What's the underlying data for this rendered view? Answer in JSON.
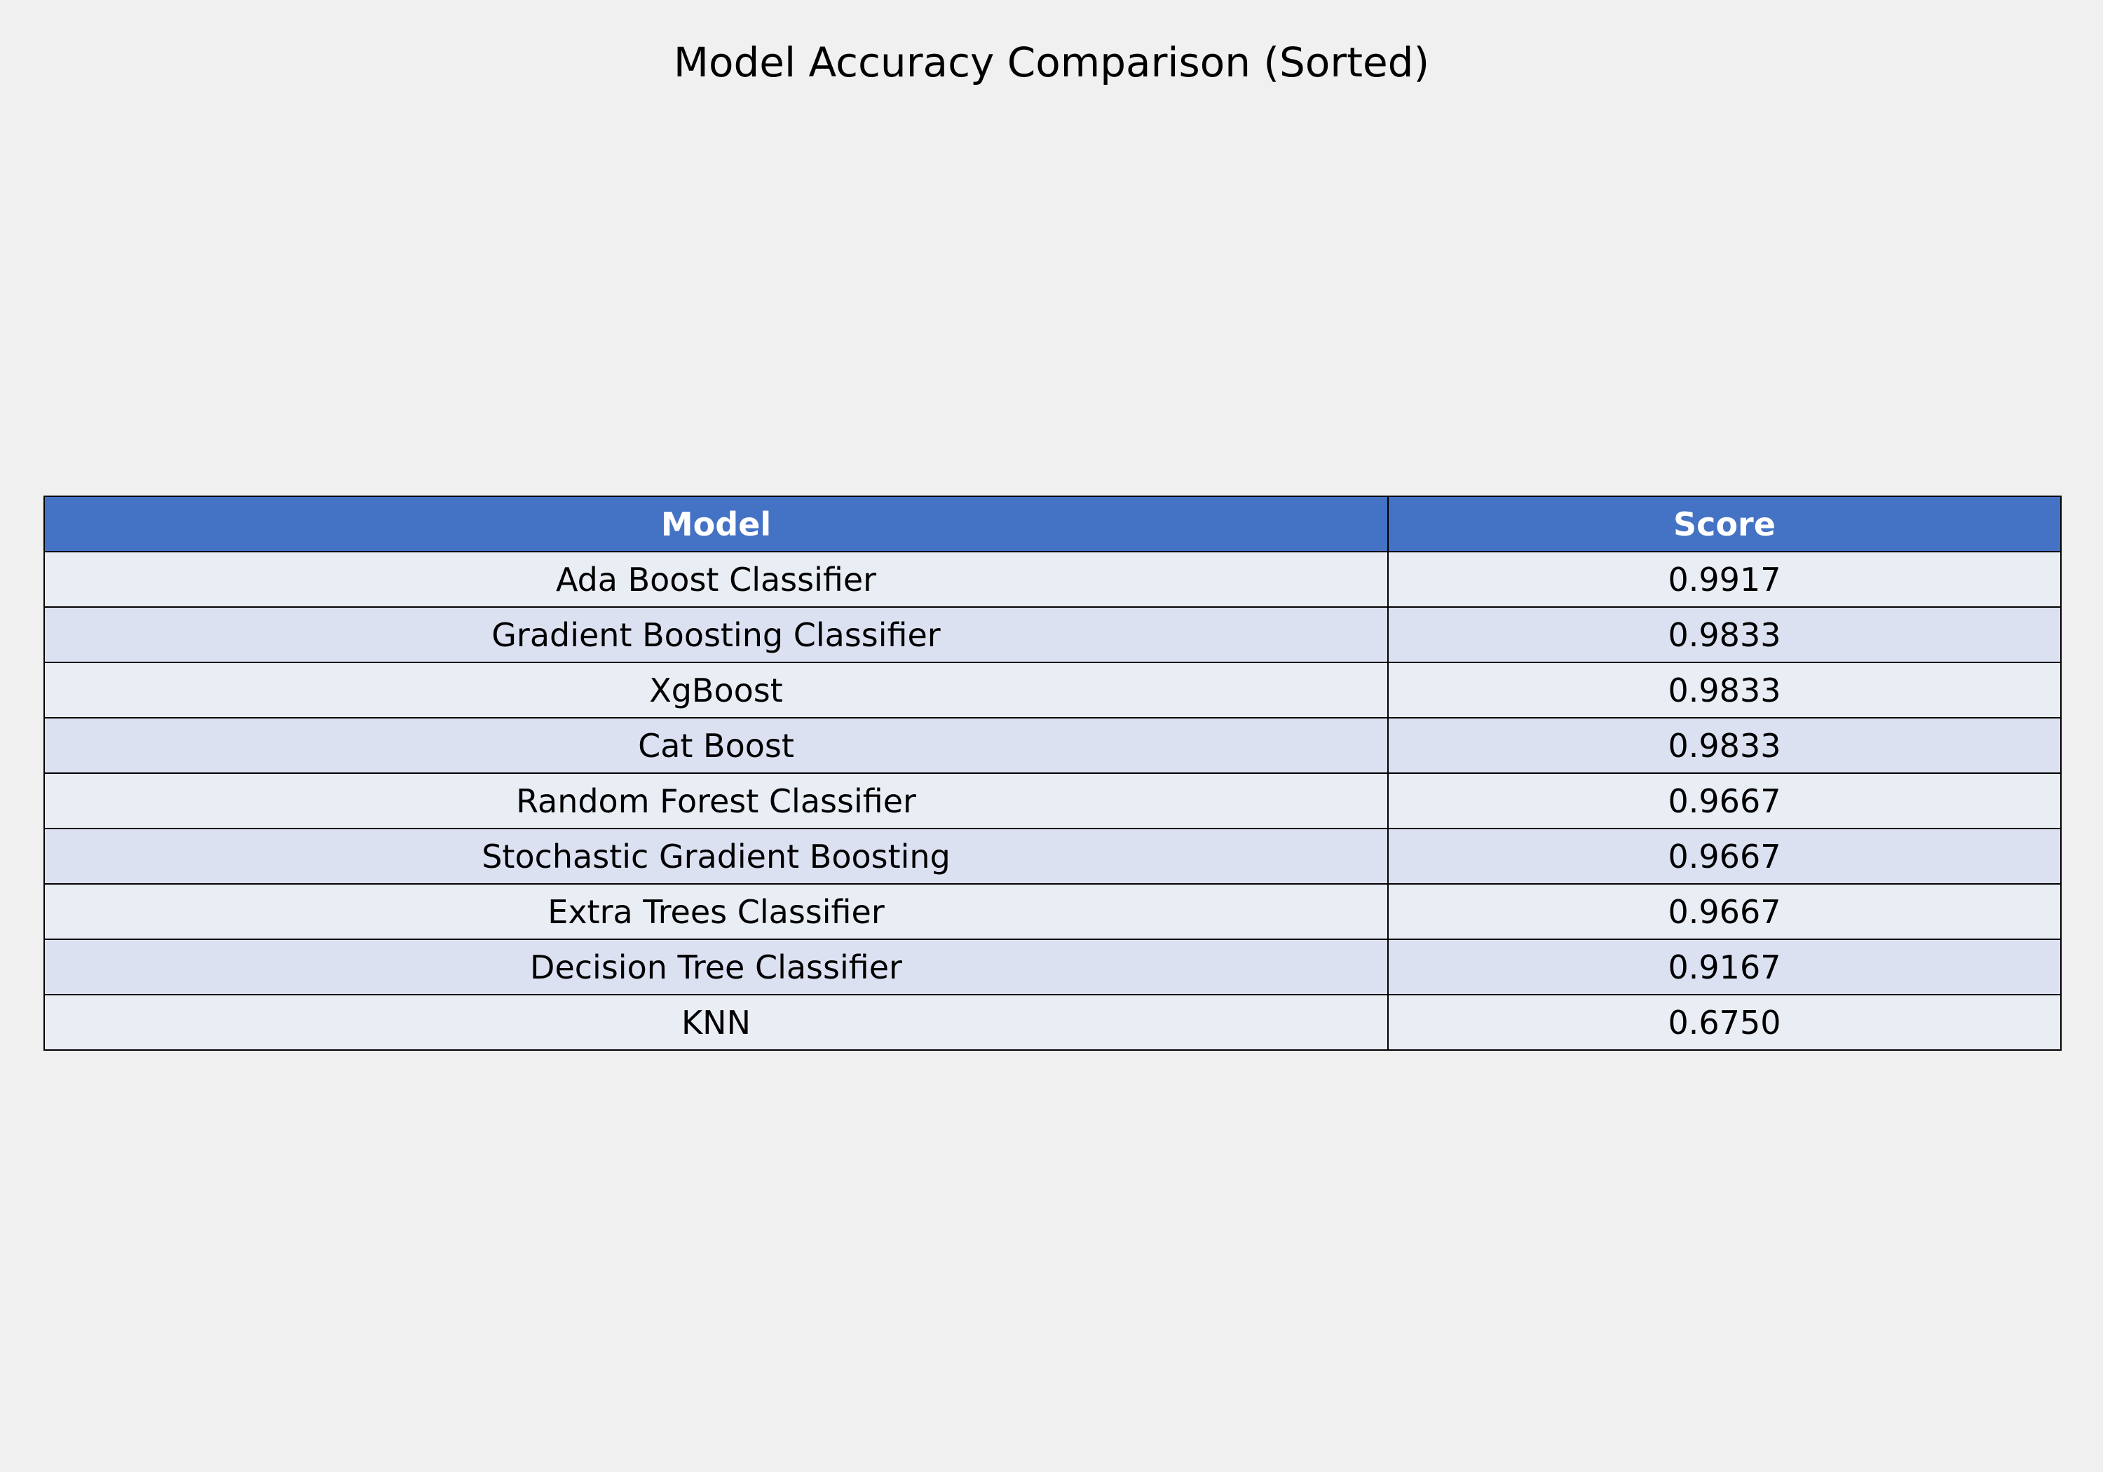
{
  "chart_data": {
    "type": "table",
    "title": "Model Accuracy Comparison (Sorted)",
    "columns": [
      "Model",
      "Score"
    ],
    "rows": [
      [
        "Ada Boost Classifier",
        "0.9917"
      ],
      [
        "Gradient Boosting Classifier",
        "0.9833"
      ],
      [
        "XgBoost",
        "0.9833"
      ],
      [
        "Cat Boost",
        "0.9833"
      ],
      [
        "Random Forest Classifier",
        "0.9667"
      ],
      [
        "Stochastic Gradient Boosting",
        "0.9667"
      ],
      [
        "Extra Trees Classifier",
        "0.9667"
      ],
      [
        "Decision Tree Classifier",
        "0.9167"
      ],
      [
        "KNN",
        "0.6750"
      ]
    ],
    "sort_order": "descending by Score"
  },
  "colors": {
    "background": "#f0f0f0",
    "header_fill": "#4472c4",
    "header_text": "#ffffff",
    "row_fill_odd": "#e9edf4",
    "row_fill_even": "#dce1f2",
    "border": "#000000"
  }
}
